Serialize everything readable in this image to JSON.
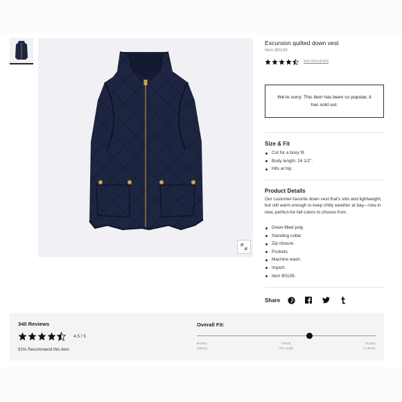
{
  "product": {
    "title": "Excursion quilted down vest",
    "item_number": "Item B0109",
    "rating": 4.5,
    "reviews_link": "340 REVIEWS",
    "soldout_message": "We're sorry. This item has been so popular, it has sold out."
  },
  "size_fit": {
    "heading": "Size & Fit",
    "items": [
      "Cut for a boxy fit.",
      "Body length: 24 1/2\".",
      "Hits at hip."
    ]
  },
  "details": {
    "heading": "Product Details",
    "description": "Our customer-favorite down vest that's slim and lightweight, but still warm enough to keep chilly weather at bay—now in new, perfect-for-fall colors to choose from.",
    "items": [
      "Down-filled poly.",
      "Standing collar.",
      "Zip closure.",
      "Pockets.",
      "Machine wash.",
      "Import.",
      "Item B0109."
    ]
  },
  "share": {
    "label": "Share",
    "icons": [
      "pinterest-icon",
      "facebook-icon",
      "twitter-icon",
      "tumblr-icon"
    ]
  },
  "reviews": {
    "count_label": "340 Reviews",
    "score": "4.5 / 5",
    "rating": 4.5,
    "recommend": "91% Recommend this item"
  },
  "fit": {
    "title": "Overall Fit:",
    "value": 0.63,
    "labels": {
      "left_1": "RUNS",
      "left_2": "SMALL",
      "mid_1": "TRUE",
      "mid_2": "TO SIZE",
      "right_1": "RUNS",
      "right_2": "LARGE"
    }
  },
  "colors": {
    "vest": "#1d2540",
    "text": "#222222",
    "panel": "#f1f0f4"
  }
}
